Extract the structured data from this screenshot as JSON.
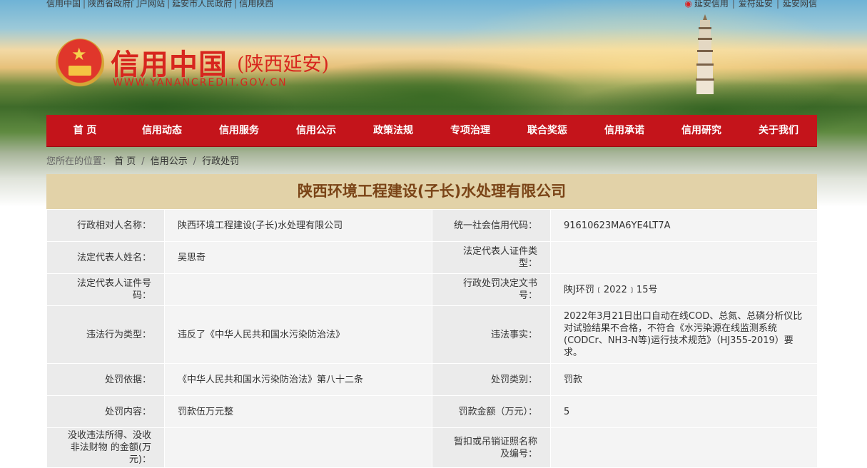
{
  "top_links": {
    "left": [
      "信用中国",
      "陕西省政府门户网站",
      "延安市人民政府",
      "信用陕西"
    ],
    "right": [
      "延安信用",
      "爱符延安",
      "延安网信"
    ]
  },
  "logo": {
    "main": "信用中国",
    "sub": "(陕西延安)",
    "url": "WWW.YANANCREDIT.GOV.CN"
  },
  "nav": [
    "首 页",
    "信用动态",
    "信用服务",
    "信用公示",
    "政策法规",
    "专项治理",
    "联合奖惩",
    "信用承诺",
    "信用研究",
    "关于我们"
  ],
  "breadcrumb": {
    "label": "您所在的位置：",
    "items": [
      "首 页",
      "信用公示",
      "行政处罚"
    ]
  },
  "record": {
    "title": "陕西环境工程建设(子长)水处理有限公司",
    "rows": [
      {
        "k1": "行政相对人名称：",
        "v1": "陕西环境工程建设(子长)水处理有限公司",
        "k2": "统一社会信用代码：",
        "v2": "91610623MA6YE4LT7A"
      },
      {
        "k1": "法定代表人姓名：",
        "v1": "吴思奇",
        "k2": "法定代表人证件类型：",
        "v2": ""
      },
      {
        "k1": "法定代表人证件号码：",
        "v1": "",
        "k2": "行政处罚决定文书号：",
        "v2": "陕J环罚﹝2022﹞15号"
      },
      {
        "k1": "违法行为类型：",
        "v1": "违反了《中华人民共和国水污染防治法》",
        "k2": "违法事实：",
        "v2": "2022年3月21日出口自动在线COD、总氮、总磷分析仪比对试验结果不合格，不符合《水污染源在线监测系统(CODCr、NH3-N等)运行技术规范》（HJ355-2019）要求。"
      },
      {
        "k1": "处罚依据：",
        "v1": "《中华人民共和国水污染防治法》第八十二条",
        "k2": "处罚类别：",
        "v2": "罚款"
      },
      {
        "k1": "处罚内容：",
        "v1": "罚款伍万元整",
        "k2": "罚款金额（万元）：",
        "v2": "5"
      },
      {
        "k1": "没收违法所得、没收非法财物 的金额(万元)：",
        "v1": "",
        "k2": "暂扣或吊销证照名称及编号：",
        "v2": ""
      }
    ]
  }
}
